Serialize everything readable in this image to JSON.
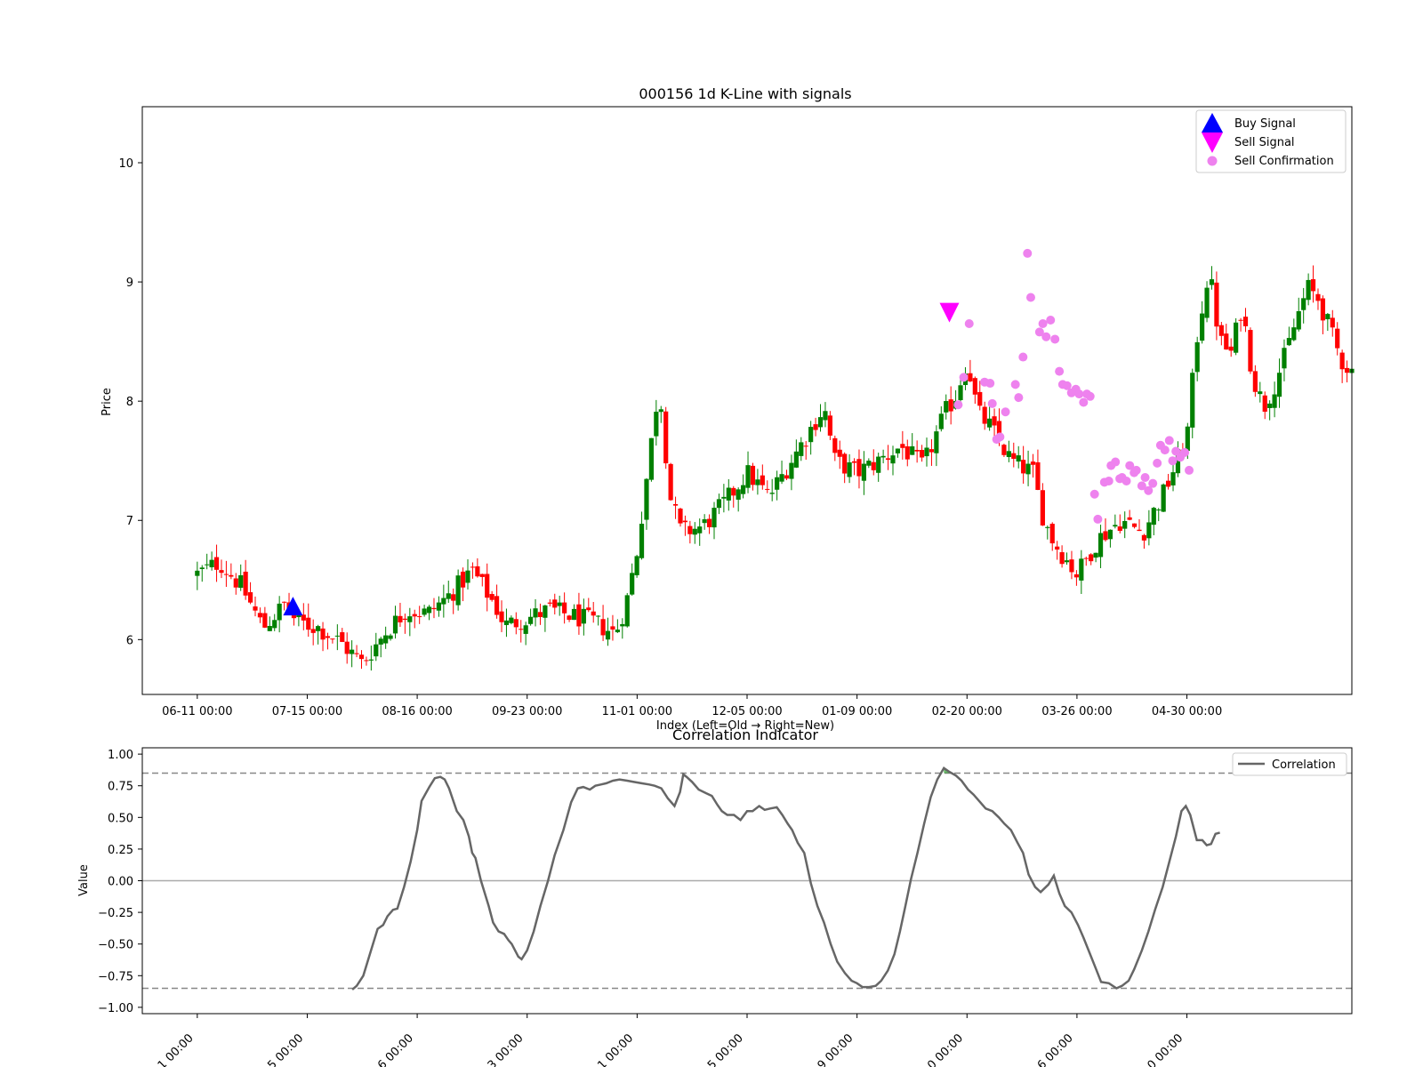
{
  "chart_data": [
    {
      "type": "candlestick",
      "title": "000156 1d K-Line with signals",
      "xlabel": "Index (Left=Old → Right=New)",
      "ylabel": "Price",
      "ylim": [
        5.54,
        10.47
      ],
      "xlim": [
        -5,
        105
      ],
      "yticks": [
        6,
        7,
        8,
        9,
        10
      ],
      "xticks": [
        {
          "x": 0,
          "label": "06-11 00:00"
        },
        {
          "x": 10,
          "label": "07-15 00:00"
        },
        {
          "x": 20,
          "label": "08-16 00:00"
        },
        {
          "x": 30,
          "label": "09-23 00:00"
        },
        {
          "x": 40,
          "label": "11-01 00:00"
        },
        {
          "x": 50,
          "label": "12-05 00:00"
        },
        {
          "x": 60,
          "label": "01-09 00:00"
        },
        {
          "x": 70,
          "label": "02-20 00:00"
        },
        {
          "x": 80,
          "label": "03-26 00:00"
        },
        {
          "x": 90,
          "label": "04-30 00:00"
        }
      ],
      "colors": {
        "up": "#008000",
        "down": "#ff0000"
      },
      "close_points": [
        [
          0,
          6.55
        ],
        [
          2,
          6.65
        ],
        [
          4,
          6.45
        ],
        [
          6,
          6.1
        ],
        [
          8,
          6.3
        ],
        [
          9,
          6.15
        ],
        [
          11,
          6.1
        ],
        [
          13,
          5.98
        ],
        [
          15,
          5.8
        ],
        [
          17,
          6.05
        ],
        [
          19,
          6.25
        ],
        [
          21,
          6.22
        ],
        [
          23,
          6.38
        ],
        [
          25,
          6.58
        ],
        [
          27,
          6.3
        ],
        [
          28,
          6.12
        ],
        [
          30,
          6.18
        ],
        [
          32,
          6.25
        ],
        [
          34,
          6.2
        ],
        [
          36,
          6.15
        ],
        [
          38,
          6.05
        ],
        [
          39,
          6.3
        ],
        [
          40,
          6.75
        ],
        [
          41,
          7.45
        ],
        [
          42,
          8.15
        ],
        [
          43,
          7.2
        ],
        [
          44,
          6.9
        ],
        [
          46,
          6.95
        ],
        [
          48,
          7.15
        ],
        [
          50,
          7.4
        ],
        [
          52,
          7.2
        ],
        [
          54,
          7.5
        ],
        [
          56,
          7.8
        ],
        [
          57,
          7.95
        ],
        [
          58,
          7.5
        ],
        [
          60,
          7.4
        ],
        [
          62,
          7.5
        ],
        [
          64,
          7.62
        ],
        [
          66,
          7.45
        ],
        [
          68,
          7.9
        ],
        [
          69,
          8.05
        ],
        [
          70,
          8.35
        ],
        [
          71,
          7.9
        ],
        [
          72,
          7.8
        ],
        [
          74,
          7.5
        ],
        [
          76,
          7.4
        ],
        [
          77,
          7.0
        ],
        [
          78,
          6.8
        ],
        [
          80,
          6.55
        ],
        [
          82,
          6.85
        ],
        [
          84,
          7.0
        ],
        [
          86,
          6.9
        ],
        [
          88,
          7.25
        ],
        [
          90,
          7.7
        ],
        [
          91,
          8.6
        ],
        [
          92,
          9.1
        ],
        [
          93,
          8.5
        ],
        [
          94,
          8.4
        ],
        [
          95,
          8.8
        ],
        [
          96,
          8.2
        ],
        [
          97,
          7.95
        ],
        [
          98,
          8.15
        ],
        [
          99,
          8.4
        ],
        [
          100,
          8.7
        ],
        [
          101,
          8.95
        ],
        [
          102,
          8.85
        ],
        [
          103,
          8.6
        ],
        [
          104,
          8.35
        ],
        [
          105,
          8.25
        ]
      ],
      "buy_signals": [
        {
          "x": 8.7,
          "y": 6.27
        }
      ],
      "sell_signals": [
        {
          "x": 68.4,
          "y": 8.75
        }
      ],
      "sell_confirmations": [
        {
          "x": 69.2,
          "y": 7.97
        },
        {
          "x": 69.7,
          "y": 8.2
        },
        {
          "x": 70.2,
          "y": 8.65
        },
        {
          "x": 71.6,
          "y": 8.16
        },
        {
          "x": 72.1,
          "y": 8.15
        },
        {
          "x": 72.3,
          "y": 7.98
        },
        {
          "x": 72.7,
          "y": 7.68
        },
        {
          "x": 73.0,
          "y": 7.7
        },
        {
          "x": 73.5,
          "y": 7.91
        },
        {
          "x": 74.4,
          "y": 8.14
        },
        {
          "x": 74.7,
          "y": 8.03
        },
        {
          "x": 75.1,
          "y": 8.37
        },
        {
          "x": 75.5,
          "y": 9.24
        },
        {
          "x": 75.8,
          "y": 8.87
        },
        {
          "x": 76.6,
          "y": 8.58
        },
        {
          "x": 76.9,
          "y": 8.65
        },
        {
          "x": 77.2,
          "y": 8.54
        },
        {
          "x": 77.6,
          "y": 8.68
        },
        {
          "x": 78.0,
          "y": 8.52
        },
        {
          "x": 78.4,
          "y": 8.25
        },
        {
          "x": 78.7,
          "y": 8.14
        },
        {
          "x": 79.1,
          "y": 8.13
        },
        {
          "x": 79.5,
          "y": 8.07
        },
        {
          "x": 79.9,
          "y": 8.1
        },
        {
          "x": 80.2,
          "y": 8.06
        },
        {
          "x": 80.6,
          "y": 7.99
        },
        {
          "x": 80.9,
          "y": 8.06
        },
        {
          "x": 81.2,
          "y": 8.04
        },
        {
          "x": 81.6,
          "y": 7.22
        },
        {
          "x": 81.9,
          "y": 7.01
        },
        {
          "x": 82.5,
          "y": 7.32
        },
        {
          "x": 82.9,
          "y": 7.33
        },
        {
          "x": 83.1,
          "y": 7.46
        },
        {
          "x": 83.5,
          "y": 7.49
        },
        {
          "x": 83.9,
          "y": 7.35
        },
        {
          "x": 84.1,
          "y": 7.36
        },
        {
          "x": 84.5,
          "y": 7.33
        },
        {
          "x": 84.8,
          "y": 7.46
        },
        {
          "x": 85.2,
          "y": 7.4
        },
        {
          "x": 85.4,
          "y": 7.42
        },
        {
          "x": 85.9,
          "y": 7.29
        },
        {
          "x": 86.2,
          "y": 7.36
        },
        {
          "x": 86.5,
          "y": 7.25
        },
        {
          "x": 86.9,
          "y": 7.31
        },
        {
          "x": 87.3,
          "y": 7.48
        },
        {
          "x": 87.6,
          "y": 7.63
        },
        {
          "x": 88.0,
          "y": 7.59
        },
        {
          "x": 88.4,
          "y": 7.67
        },
        {
          "x": 88.7,
          "y": 7.5
        },
        {
          "x": 89.0,
          "y": 7.58
        },
        {
          "x": 89.4,
          "y": 7.53
        },
        {
          "x": 89.8,
          "y": 7.57
        },
        {
          "x": 90.2,
          "y": 7.42
        }
      ],
      "legend": {
        "position": "top-right",
        "entries": [
          {
            "label": "Buy Signal",
            "marker": "triangle-up",
            "color": "#0000ff"
          },
          {
            "label": "Sell Signal",
            "marker": "triangle-down",
            "color": "#ff00ff"
          },
          {
            "label": "Sell Confirmation",
            "marker": "circle",
            "color": "#ee82ee"
          }
        ]
      }
    },
    {
      "type": "line",
      "title": "Correlation Indicator",
      "ylabel": "Value",
      "ylim": [
        -1.05,
        1.05
      ],
      "xlim": [
        -5,
        105
      ],
      "yticks": [
        1.0,
        0.75,
        0.5,
        0.25,
        0.0,
        -0.25,
        -0.5,
        -0.75,
        -1.0
      ],
      "ytick_labels": [
        "1.00",
        "0.75",
        "0.50",
        "0.25",
        "0.00",
        "−0.25",
        "−0.50",
        "−0.75",
        "−1.00"
      ],
      "xtick_labels_visible": [
        "1 00:00",
        "5 00:00",
        "6 00:00",
        "3 00:00",
        "1 00:00",
        "5 00:00",
        "9 00:00",
        "0 00:00",
        "6 00:00",
        "0 00:00"
      ],
      "thresholds": [
        0.85,
        -0.85
      ],
      "zero_line": 0.0,
      "series": [
        {
          "name": "Correlation",
          "color": "#666666",
          "points": [
            [
              14.1,
              -0.86
            ],
            [
              14.5,
              -0.83
            ],
            [
              15.1,
              -0.75
            ],
            [
              15.8,
              -0.55
            ],
            [
              16.4,
              -0.38
            ],
            [
              16.9,
              -0.35
            ],
            [
              17.3,
              -0.28
            ],
            [
              17.8,
              -0.23
            ],
            [
              18.2,
              -0.22
            ],
            [
              18.8,
              -0.05
            ],
            [
              19.4,
              0.15
            ],
            [
              20.0,
              0.4
            ],
            [
              20.4,
              0.63
            ],
            [
              21.1,
              0.74
            ],
            [
              21.6,
              0.81
            ],
            [
              22.1,
              0.82
            ],
            [
              22.5,
              0.8
            ],
            [
              22.9,
              0.73
            ],
            [
              23.6,
              0.55
            ],
            [
              24.2,
              0.48
            ],
            [
              24.7,
              0.35
            ],
            [
              25.0,
              0.22
            ],
            [
              25.3,
              0.18
            ],
            [
              25.8,
              0.0
            ],
            [
              26.5,
              -0.2
            ],
            [
              26.9,
              -0.33
            ],
            [
              27.4,
              -0.4
            ],
            [
              27.9,
              -0.42
            ],
            [
              28.3,
              -0.47
            ],
            [
              28.6,
              -0.5
            ],
            [
              29.2,
              -0.6
            ],
            [
              29.5,
              -0.62
            ],
            [
              30.0,
              -0.55
            ],
            [
              30.6,
              -0.4
            ],
            [
              31.2,
              -0.2
            ],
            [
              31.9,
              0.0
            ],
            [
              32.5,
              0.2
            ],
            [
              33.3,
              0.4
            ],
            [
              34.0,
              0.62
            ],
            [
              34.6,
              0.73
            ],
            [
              35.1,
              0.74
            ],
            [
              35.7,
              0.72
            ],
            [
              36.2,
              0.75
            ],
            [
              36.7,
              0.76
            ],
            [
              37.2,
              0.77
            ],
            [
              37.8,
              0.79
            ],
            [
              38.4,
              0.8
            ],
            [
              39.1,
              0.79
            ],
            [
              39.7,
              0.78
            ],
            [
              40.4,
              0.77
            ],
            [
              41.1,
              0.76
            ],
            [
              41.6,
              0.75
            ],
            [
              42.2,
              0.73
            ],
            [
              42.8,
              0.65
            ],
            [
              43.4,
              0.59
            ],
            [
              43.9,
              0.7
            ],
            [
              44.2,
              0.84
            ],
            [
              44.5,
              0.82
            ],
            [
              45.0,
              0.78
            ],
            [
              45.6,
              0.72
            ],
            [
              46.3,
              0.69
            ],
            [
              46.8,
              0.67
            ],
            [
              47.3,
              0.6
            ],
            [
              47.7,
              0.55
            ],
            [
              48.2,
              0.52
            ],
            [
              48.8,
              0.52
            ],
            [
              49.4,
              0.48
            ],
            [
              50.0,
              0.55
            ],
            [
              50.5,
              0.55
            ],
            [
              51.1,
              0.59
            ],
            [
              51.6,
              0.56
            ],
            [
              52.1,
              0.57
            ],
            [
              52.7,
              0.58
            ],
            [
              53.2,
              0.52
            ],
            [
              53.7,
              0.45
            ],
            [
              54.1,
              0.4
            ],
            [
              54.6,
              0.3
            ],
            [
              55.2,
              0.22
            ],
            [
              55.8,
              -0.02
            ],
            [
              56.4,
              -0.2
            ],
            [
              57.0,
              -0.33
            ],
            [
              57.6,
              -0.5
            ],
            [
              58.2,
              -0.64
            ],
            [
              58.9,
              -0.73
            ],
            [
              59.5,
              -0.79
            ],
            [
              60.0,
              -0.81
            ],
            [
              60.5,
              -0.84
            ],
            [
              61.1,
              -0.84
            ],
            [
              61.7,
              -0.83
            ],
            [
              62.2,
              -0.79
            ],
            [
              62.8,
              -0.71
            ],
            [
              63.4,
              -0.58
            ],
            [
              63.9,
              -0.4
            ],
            [
              64.4,
              -0.2
            ],
            [
              64.9,
              0.01
            ],
            [
              65.5,
              0.22
            ],
            [
              66.1,
              0.45
            ],
            [
              66.7,
              0.66
            ],
            [
              67.3,
              0.8
            ],
            [
              67.9,
              0.89
            ],
            [
              68.4,
              0.86
            ],
            [
              69.0,
              0.83
            ],
            [
              69.5,
              0.79
            ],
            [
              70.1,
              0.72
            ],
            [
              70.6,
              0.68
            ],
            [
              71.2,
              0.62
            ],
            [
              71.7,
              0.57
            ],
            [
              72.3,
              0.55
            ],
            [
              72.9,
              0.5
            ],
            [
              73.4,
              0.45
            ],
            [
              74.0,
              0.4
            ],
            [
              74.6,
              0.3
            ],
            [
              75.1,
              0.22
            ],
            [
              75.6,
              0.05
            ],
            [
              76.2,
              -0.05
            ],
            [
              76.7,
              -0.09
            ],
            [
              77.4,
              -0.03
            ],
            [
              77.9,
              0.04
            ],
            [
              78.4,
              -0.1
            ],
            [
              78.9,
              -0.2
            ],
            [
              79.5,
              -0.25
            ],
            [
              80.1,
              -0.35
            ],
            [
              80.6,
              -0.45
            ],
            [
              81.2,
              -0.58
            ],
            [
              81.7,
              -0.69
            ],
            [
              82.2,
              -0.8
            ],
            [
              82.9,
              -0.81
            ],
            [
              83.6,
              -0.85
            ],
            [
              84.1,
              -0.83
            ],
            [
              84.7,
              -0.79
            ],
            [
              85.2,
              -0.7
            ],
            [
              85.9,
              -0.55
            ],
            [
              86.5,
              -0.4
            ],
            [
              87.1,
              -0.23
            ],
            [
              87.8,
              -0.05
            ],
            [
              88.4,
              0.15
            ],
            [
              89.0,
              0.35
            ],
            [
              89.5,
              0.55
            ],
            [
              89.9,
              0.59
            ],
            [
              90.3,
              0.52
            ],
            [
              90.9,
              0.32
            ],
            [
              91.4,
              0.32
            ],
            [
              91.8,
              0.28
            ],
            [
              92.2,
              0.29
            ],
            [
              92.6,
              0.37
            ],
            [
              93.0,
              0.38
            ]
          ]
        }
      ],
      "legend": {
        "position": "top-right"
      }
    }
  ]
}
